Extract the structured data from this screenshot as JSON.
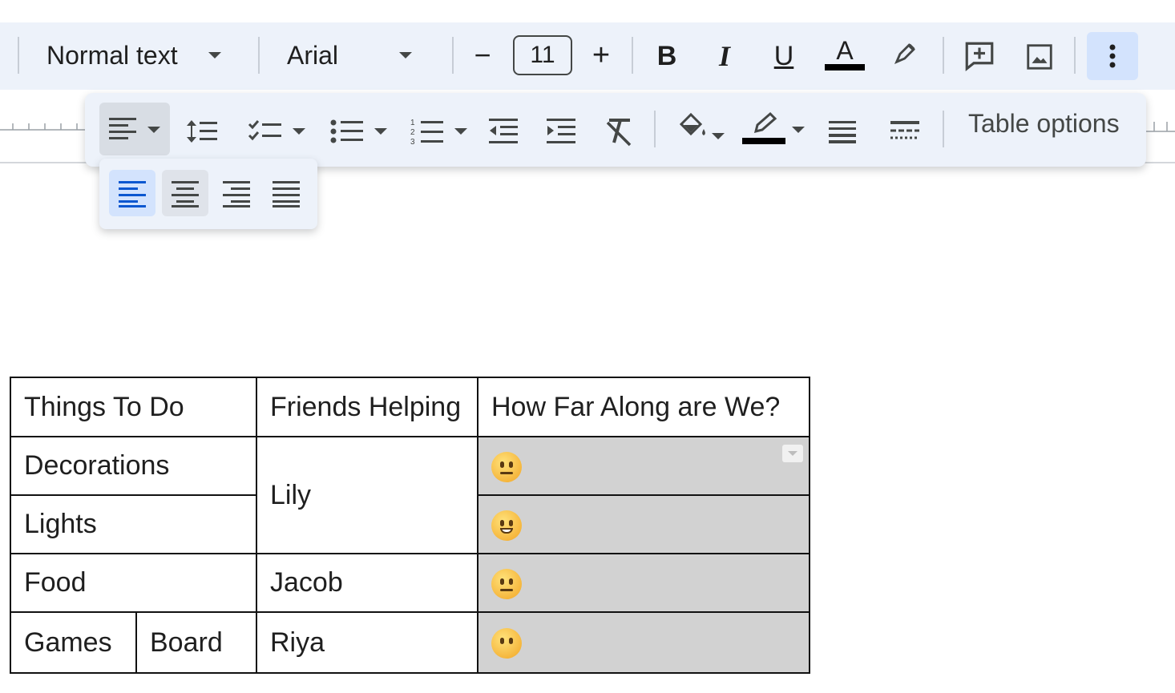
{
  "toolbar": {
    "style_select": "Normal text",
    "font_select": "Arial",
    "font_size": "11",
    "decrease_size": "−",
    "increase_size": "+",
    "bold": "B",
    "italic": "I",
    "underline": "U",
    "text_color": "A"
  },
  "toolbar2": {
    "table_options": "Table options"
  },
  "table": {
    "headers": [
      "Things To Do",
      "Friends Helping",
      "How Far Along are We?"
    ],
    "rows": {
      "decorations": "Decorations",
      "lights": "Lights",
      "lily": "Lily",
      "food": "Food",
      "jacob": "Jacob",
      "games": "Games",
      "board": "Board",
      "riya": "Riya"
    },
    "progress_emojis": [
      "neutral-face",
      "grinning-face",
      "neutral-face",
      "face-without-mouth"
    ]
  },
  "colors": {
    "toolbar_bg": "#edf2fa",
    "active_button": "#d3e3fd",
    "progress_cell_bg": "#d2d2d2"
  }
}
